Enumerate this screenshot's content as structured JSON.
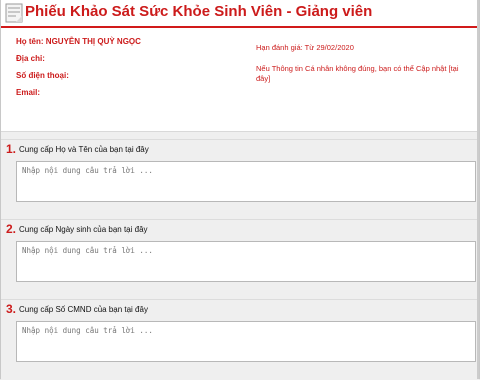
{
  "header": {
    "title": "Phiếu Khảo Sát Sức Khỏe Sinh Viên - Giảng viên",
    "icon": "form-document-icon"
  },
  "profile": {
    "name_label": "Họ tên:",
    "name_value": "NGUYỄN THỊ QUỲ NGỌC",
    "address_label": "Địa chỉ:",
    "phone_label": "Số điện thoại:",
    "email_label": "Email:",
    "deadline": "Hạn đánh giá: Từ 29/02/2020",
    "update_note": "Nếu Thông tin Cá nhân không đúng, bạn có thể Cập nhật [tại đây]"
  },
  "questions": [
    {
      "number": "1.",
      "text": "Cung cấp Họ và Tên của bạn tại đây",
      "placeholder": "Nhập nội dung câu trả lời ..."
    },
    {
      "number": "2.",
      "text": "Cung cấp Ngày sinh của bạn tại đây",
      "placeholder": "Nhập nội dung câu trả lời ..."
    },
    {
      "number": "3.",
      "text": "Cung cấp Số CMND của bạn tại đây",
      "placeholder": "Nhập nội dung câu trả lời ..."
    }
  ],
  "colors": {
    "accent": "#cc1b1b",
    "background": "#efefef"
  }
}
